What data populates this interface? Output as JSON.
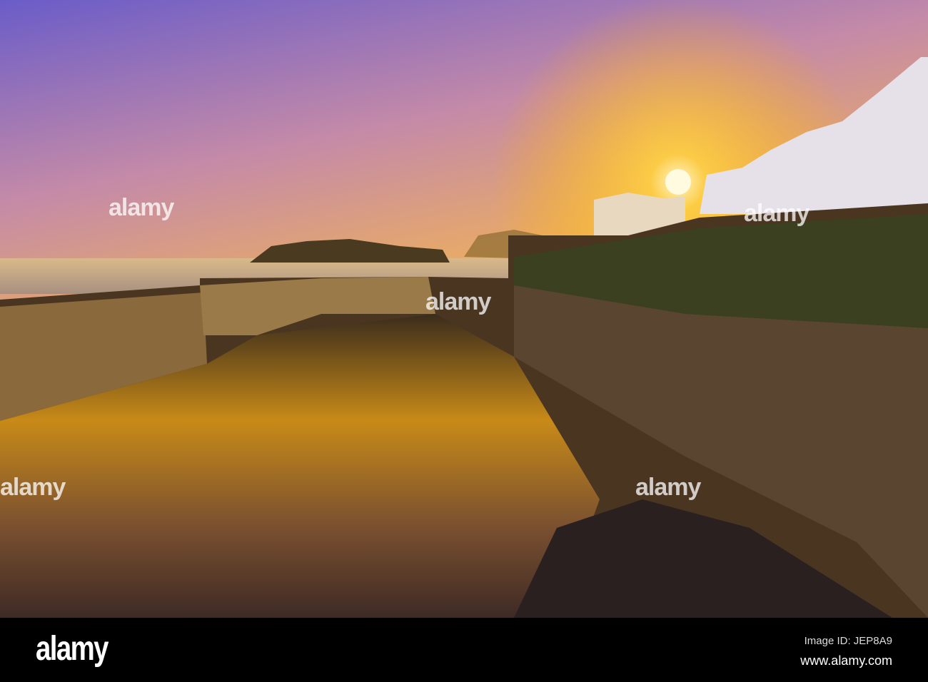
{
  "photo": {
    "subject": "harbour-sunset"
  },
  "watermark": {
    "text": "alamy"
  },
  "footer": {
    "logo": "alamy",
    "image_id": "Image ID: JEP8A9",
    "url": "www.alamy.com"
  },
  "colors": {
    "sky_top": "#6b5fc9",
    "sky_mid": "#f0a640",
    "sun": "#fff6c0",
    "water": "#c98a1a"
  }
}
